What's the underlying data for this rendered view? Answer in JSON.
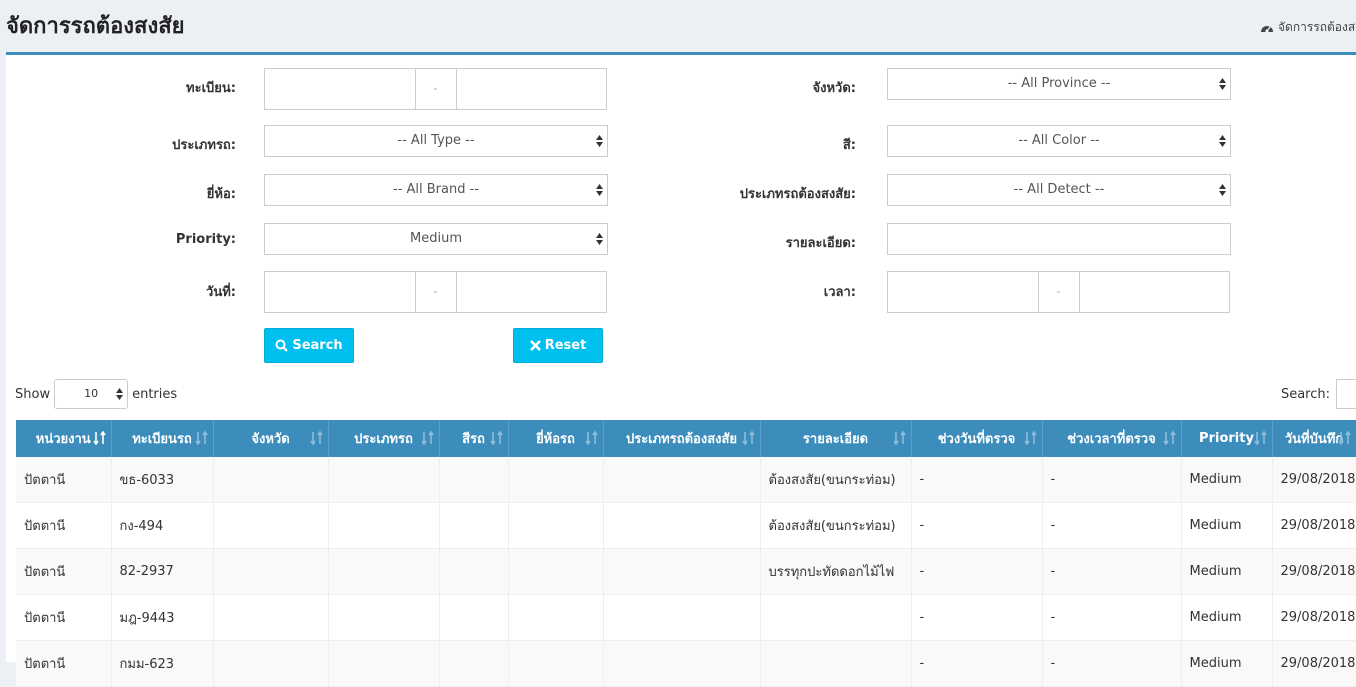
{
  "header": {
    "title": "จัดการรถต้องสงสัย",
    "breadcrumb": "จัดการรถต้องสงสัย"
  },
  "form": {
    "plate_label": "ทะเบียน:",
    "plate_sep": "-",
    "province_label": "จังหวัด:",
    "province_value": "-- All Province --",
    "type_label": "ประเภทรถ:",
    "type_value": "-- All Type --",
    "color_label": "สี:",
    "color_value": "-- All Color --",
    "brand_label": "ยี่ห้อ:",
    "brand_value": "-- All Brand --",
    "detect_label": "ประเภทรถต้องสงสัย:",
    "detect_value": "-- All Detect --",
    "priority_label": "Priority:",
    "priority_value": "Medium",
    "detail_label": "รายละเอียด:",
    "date_label": "วันที่:",
    "date_sep": "-",
    "time_label": "เวลา:",
    "time_sep": "-",
    "search_button": "Search",
    "reset_button": "Reset"
  },
  "table_controls": {
    "show_label": "Show",
    "page_length": "10",
    "entries_label": "entries",
    "search_label": "Search:"
  },
  "table": {
    "headers": [
      "หน่วยงาน",
      "ทะเบียนรถ",
      "จังหวัด",
      "ประเภทรถ",
      "สีรถ",
      "ยี่ห้อรถ",
      "ประเภทรถต้องสงสัย",
      "รายละเอียด",
      "ช่วงวันที่ตรวจ",
      "ช่วงเวลาที่ตรวจ",
      "Priority",
      "วันที่บันทึก"
    ],
    "rows": [
      [
        "ปัตตานี",
        "ขธ-6033",
        "",
        "",
        "",
        "",
        "",
        "ต้องสงสัย(ขนกระท่อม)",
        "-",
        "-",
        "Medium",
        "29/08/2018"
      ],
      [
        "ปัตตานี",
        "กง-494",
        "",
        "",
        "",
        "",
        "",
        "ต้องสงสัย(ขนกระท่อม)",
        "-",
        "-",
        "Medium",
        "29/08/2018"
      ],
      [
        "ปัตตานี",
        "82-2937",
        "",
        "",
        "",
        "",
        "",
        "บรรทุกปะทัดดอกไม้ไฟ",
        "-",
        "-",
        "Medium",
        "29/08/2018"
      ],
      [
        "ปัตตานี",
        "มฎ-9443",
        "",
        "",
        "",
        "",
        "",
        "",
        "-",
        "-",
        "Medium",
        "29/08/2018"
      ],
      [
        "ปัตตานี",
        "กมม-623",
        "",
        "",
        "",
        "",
        "",
        "",
        "-",
        "-",
        "Medium",
        "29/08/2018"
      ]
    ]
  }
}
